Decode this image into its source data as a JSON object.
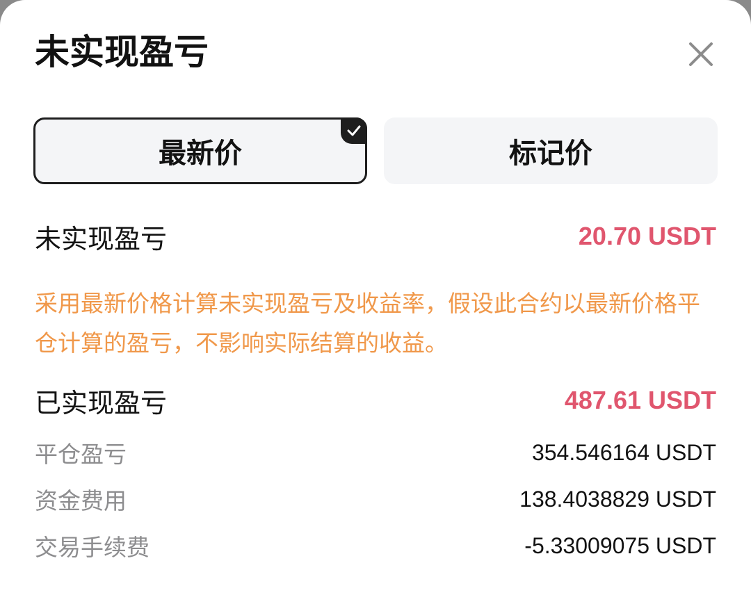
{
  "header": {
    "title": "未实现盈亏",
    "close_icon": "close-icon"
  },
  "segments": [
    {
      "label": "最新价",
      "selected": true
    },
    {
      "label": "标记价",
      "selected": false
    }
  ],
  "unrealized": {
    "label": "未实现盈亏",
    "value": "20.70 USDT",
    "note": "采用最新价格计算未实现盈亏及收益率，假设此合约以最新价格平仓计算的盈亏，不影响实际结算的收益。"
  },
  "realized": {
    "label": "已实现盈亏",
    "value": "487.61 USDT",
    "items": [
      {
        "label": "平仓盈亏",
        "value": "354.546164 USDT"
      },
      {
        "label": "资金费用",
        "value": "138.4038829 USDT"
      },
      {
        "label": "交易手续费",
        "value": "-5.33009075 USDT"
      }
    ]
  },
  "colors": {
    "profit": "#e0566e",
    "note": "#f0984a",
    "muted": "#8d8d8f",
    "text": "#121212"
  }
}
